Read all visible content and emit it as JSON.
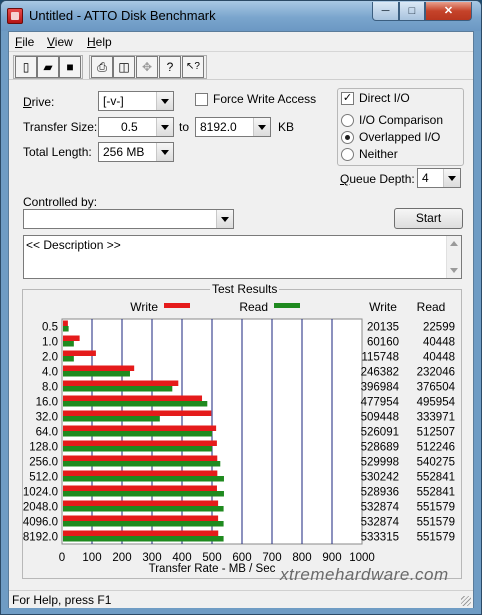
{
  "window": {
    "title": "Untitled - ATTO Disk Benchmark",
    "minimize": "─",
    "maximize": "□",
    "close": "✕"
  },
  "menu": [
    "File",
    "View",
    "Help"
  ],
  "toolbar": [
    "new-icon",
    "open-icon",
    "save-icon",
    "print-icon",
    "print-preview-icon",
    "move-icon",
    "help-icon",
    "context-help-icon"
  ],
  "toolbar_glyphs": [
    "▯",
    "▰",
    "■",
    "⎙",
    "◫",
    "✥",
    "?",
    "↖?"
  ],
  "form": {
    "drive_label": "Drive:",
    "drive_value": "[-v-]",
    "force_write_label": "Force Write Access",
    "direct_io_label": "Direct I/O",
    "direct_io_checked": "✓",
    "transfer_label": "Transfer Size:",
    "transfer_from": "0.5",
    "to_label": "to",
    "transfer_to": "8192.0",
    "kb_label": "KB",
    "total_length_label": "Total Length:",
    "total_length_value": "256 MB",
    "io_comparison": "I/O Comparison",
    "overlapped_io": "Overlapped I/O",
    "neither": "Neither",
    "queue_depth_label": "Queue Depth:",
    "queue_depth_value": "4",
    "controlled_by_label": "Controlled by:",
    "controlled_by_value": "",
    "start_button": "Start",
    "description": "<< Description >>"
  },
  "results": {
    "title": "Test Results",
    "legend_write": "Write",
    "legend_read": "Read",
    "col_write": "Write",
    "col_read": "Read",
    "xlabel": "Transfer Rate - MB / Sec"
  },
  "chart_data": {
    "type": "bar",
    "orientation": "horizontal",
    "categories": [
      "0.5",
      "1.0",
      "2.0",
      "4.0",
      "8.0",
      "16.0",
      "32.0",
      "64.0",
      "128.0",
      "256.0",
      "512.0",
      "1024.0",
      "2048.0",
      "4096.0",
      "8192.0"
    ],
    "series": [
      {
        "name": "Write",
        "color": "#e51b1b",
        "values": [
          20135,
          60160,
          115748,
          246382,
          396984,
          477954,
          509448,
          526091,
          528689,
          529998,
          530242,
          528936,
          532874,
          532874,
          533315
        ]
      },
      {
        "name": "Read",
        "color": "#1f8a1f",
        "values": [
          22599,
          40448,
          40448,
          232046,
          376504,
          495954,
          333971,
          512507,
          512246,
          540275,
          552841,
          552841,
          551579,
          551579,
          551579
        ]
      }
    ],
    "bar_scale_divisor": 1024,
    "xticks": [
      "0",
      "100",
      "200",
      "300",
      "400",
      "500",
      "600",
      "700",
      "800",
      "900",
      "1000"
    ],
    "xlim": [
      0,
      1000
    ],
    "xlabel": "Transfer Rate - MB / Sec",
    "legend": "top"
  },
  "status": {
    "text": "For Help, press F1"
  },
  "watermark": "xtremehardware.com"
}
